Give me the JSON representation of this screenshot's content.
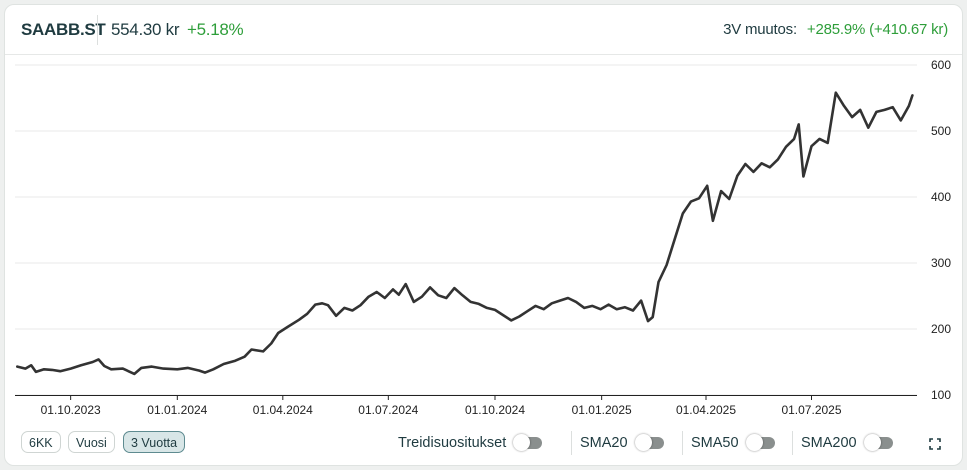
{
  "header": {
    "ticker": "SAABB.ST",
    "price": "554.30 kr",
    "change": "+5.18%",
    "period_label": "3V muutos:",
    "period_value": "+285.9% (+410.67 kr)"
  },
  "colors": {
    "line": "#333333",
    "positive": "#2e9e3a",
    "text": "#1f3b40",
    "active_button": "#d8e6e7"
  },
  "footer": {
    "ranges": [
      {
        "label": "6KK",
        "active": false
      },
      {
        "label": "Vuosi",
        "active": false
      },
      {
        "label": "3 Vuotta",
        "active": true
      }
    ],
    "toggles": [
      {
        "label": "Treidisuositukset",
        "on": false
      },
      {
        "label": "SMA20",
        "on": false
      },
      {
        "label": "SMA50",
        "on": false
      },
      {
        "label": "SMA200",
        "on": false
      }
    ],
    "expand_icon": "expand-icon"
  },
  "chart_data": {
    "type": "line",
    "title": "",
    "xlabel": "",
    "ylabel": "",
    "ylim": [
      100,
      600
    ],
    "yticks": [
      100,
      200,
      300,
      400,
      500,
      600
    ],
    "y_axis_side": "right",
    "grid": "horizontal",
    "xlim": [
      "2023-08-14",
      "2025-09-30"
    ],
    "xticks": [
      {
        "date": "2023-10-01",
        "label": "01.10.2023"
      },
      {
        "date": "2024-01-01",
        "label": "01.01.2024"
      },
      {
        "date": "2024-04-01",
        "label": "01.04.2024"
      },
      {
        "date": "2024-07-01",
        "label": "01.07.2024"
      },
      {
        "date": "2024-10-01",
        "label": "01.10.2024"
      },
      {
        "date": "2025-01-01",
        "label": "01.01.2025"
      },
      {
        "date": "2025-04-01",
        "label": "01.04.2025"
      },
      {
        "date": "2025-07-01",
        "label": "01.07.2025"
      }
    ],
    "series": [
      {
        "values": [
          [
            "2023-08-16",
            143
          ],
          [
            "2023-08-23",
            140
          ],
          [
            "2023-08-28",
            145
          ],
          [
            "2023-09-01",
            135
          ],
          [
            "2023-09-08",
            139
          ],
          [
            "2023-09-15",
            138
          ],
          [
            "2023-09-22",
            136
          ],
          [
            "2023-10-01",
            140
          ],
          [
            "2023-10-10",
            145
          ],
          [
            "2023-10-20",
            150
          ],
          [
            "2023-10-25",
            154
          ],
          [
            "2023-10-30",
            144
          ],
          [
            "2023-11-05",
            139
          ],
          [
            "2023-11-15",
            140
          ],
          [
            "2023-11-25",
            132
          ],
          [
            "2023-12-01",
            141
          ],
          [
            "2023-12-10",
            143
          ],
          [
            "2023-12-20",
            140
          ],
          [
            "2024-01-01",
            139
          ],
          [
            "2024-01-10",
            141
          ],
          [
            "2024-01-20",
            137
          ],
          [
            "2024-01-25",
            134
          ],
          [
            "2024-02-01",
            139
          ],
          [
            "2024-02-10",
            147
          ],
          [
            "2024-02-20",
            152
          ],
          [
            "2024-02-28",
            158
          ],
          [
            "2024-03-05",
            169
          ],
          [
            "2024-03-15",
            166
          ],
          [
            "2024-03-22",
            178
          ],
          [
            "2024-03-28",
            194
          ],
          [
            "2024-04-05",
            203
          ],
          [
            "2024-04-15",
            214
          ],
          [
            "2024-04-22",
            223
          ],
          [
            "2024-04-29",
            237
          ],
          [
            "2024-05-05",
            239
          ],
          [
            "2024-05-10",
            236
          ],
          [
            "2024-05-17",
            220
          ],
          [
            "2024-05-24",
            232
          ],
          [
            "2024-05-31",
            228
          ],
          [
            "2024-06-07",
            236
          ],
          [
            "2024-06-14",
            249
          ],
          [
            "2024-06-21",
            256
          ],
          [
            "2024-06-28",
            247
          ],
          [
            "2024-07-05",
            260
          ],
          [
            "2024-07-10",
            252
          ],
          [
            "2024-07-16",
            268
          ],
          [
            "2024-07-23",
            241
          ],
          [
            "2024-07-30",
            249
          ],
          [
            "2024-08-06",
            263
          ],
          [
            "2024-08-13",
            251
          ],
          [
            "2024-08-20",
            247
          ],
          [
            "2024-08-27",
            262
          ],
          [
            "2024-09-03",
            251
          ],
          [
            "2024-09-10",
            241
          ],
          [
            "2024-09-17",
            238
          ],
          [
            "2024-09-24",
            232
          ],
          [
            "2024-10-01",
            229
          ],
          [
            "2024-10-08",
            221
          ],
          [
            "2024-10-15",
            213
          ],
          [
            "2024-10-22",
            219
          ],
          [
            "2024-10-29",
            227
          ],
          [
            "2024-11-05",
            235
          ],
          [
            "2024-11-12",
            230
          ],
          [
            "2024-11-19",
            239
          ],
          [
            "2024-11-26",
            243
          ],
          [
            "2024-12-03",
            247
          ],
          [
            "2024-12-10",
            241
          ],
          [
            "2024-12-17",
            232
          ],
          [
            "2024-12-24",
            235
          ],
          [
            "2024-12-31",
            230
          ],
          [
            "2025-01-07",
            237
          ],
          [
            "2025-01-14",
            230
          ],
          [
            "2025-01-21",
            233
          ],
          [
            "2025-01-28",
            228
          ],
          [
            "2025-02-04",
            243
          ],
          [
            "2025-02-10",
            212
          ],
          [
            "2025-02-14",
            218
          ],
          [
            "2025-02-19",
            271
          ],
          [
            "2025-02-26",
            297
          ],
          [
            "2025-03-05",
            336
          ],
          [
            "2025-03-12",
            375
          ],
          [
            "2025-03-19",
            393
          ],
          [
            "2025-03-26",
            398
          ],
          [
            "2025-04-02",
            417
          ],
          [
            "2025-04-07",
            364
          ],
          [
            "2025-04-14",
            409
          ],
          [
            "2025-04-21",
            397
          ],
          [
            "2025-04-28",
            432
          ],
          [
            "2025-05-05",
            450
          ],
          [
            "2025-05-12",
            438
          ],
          [
            "2025-05-19",
            451
          ],
          [
            "2025-05-26",
            445
          ],
          [
            "2025-06-02",
            457
          ],
          [
            "2025-06-09",
            476
          ],
          [
            "2025-06-16",
            488
          ],
          [
            "2025-06-20",
            510
          ],
          [
            "2025-06-24",
            431
          ],
          [
            "2025-07-01",
            477
          ],
          [
            "2025-07-08",
            488
          ],
          [
            "2025-07-15",
            482
          ],
          [
            "2025-07-22",
            558
          ],
          [
            "2025-07-29",
            538
          ],
          [
            "2025-08-05",
            521
          ],
          [
            "2025-08-12",
            532
          ],
          [
            "2025-08-19",
            505
          ],
          [
            "2025-08-26",
            529
          ],
          [
            "2025-09-02",
            532
          ],
          [
            "2025-09-09",
            536
          ],
          [
            "2025-09-16",
            516
          ],
          [
            "2025-09-23",
            538
          ],
          [
            "2025-09-26",
            554
          ]
        ]
      }
    ]
  }
}
